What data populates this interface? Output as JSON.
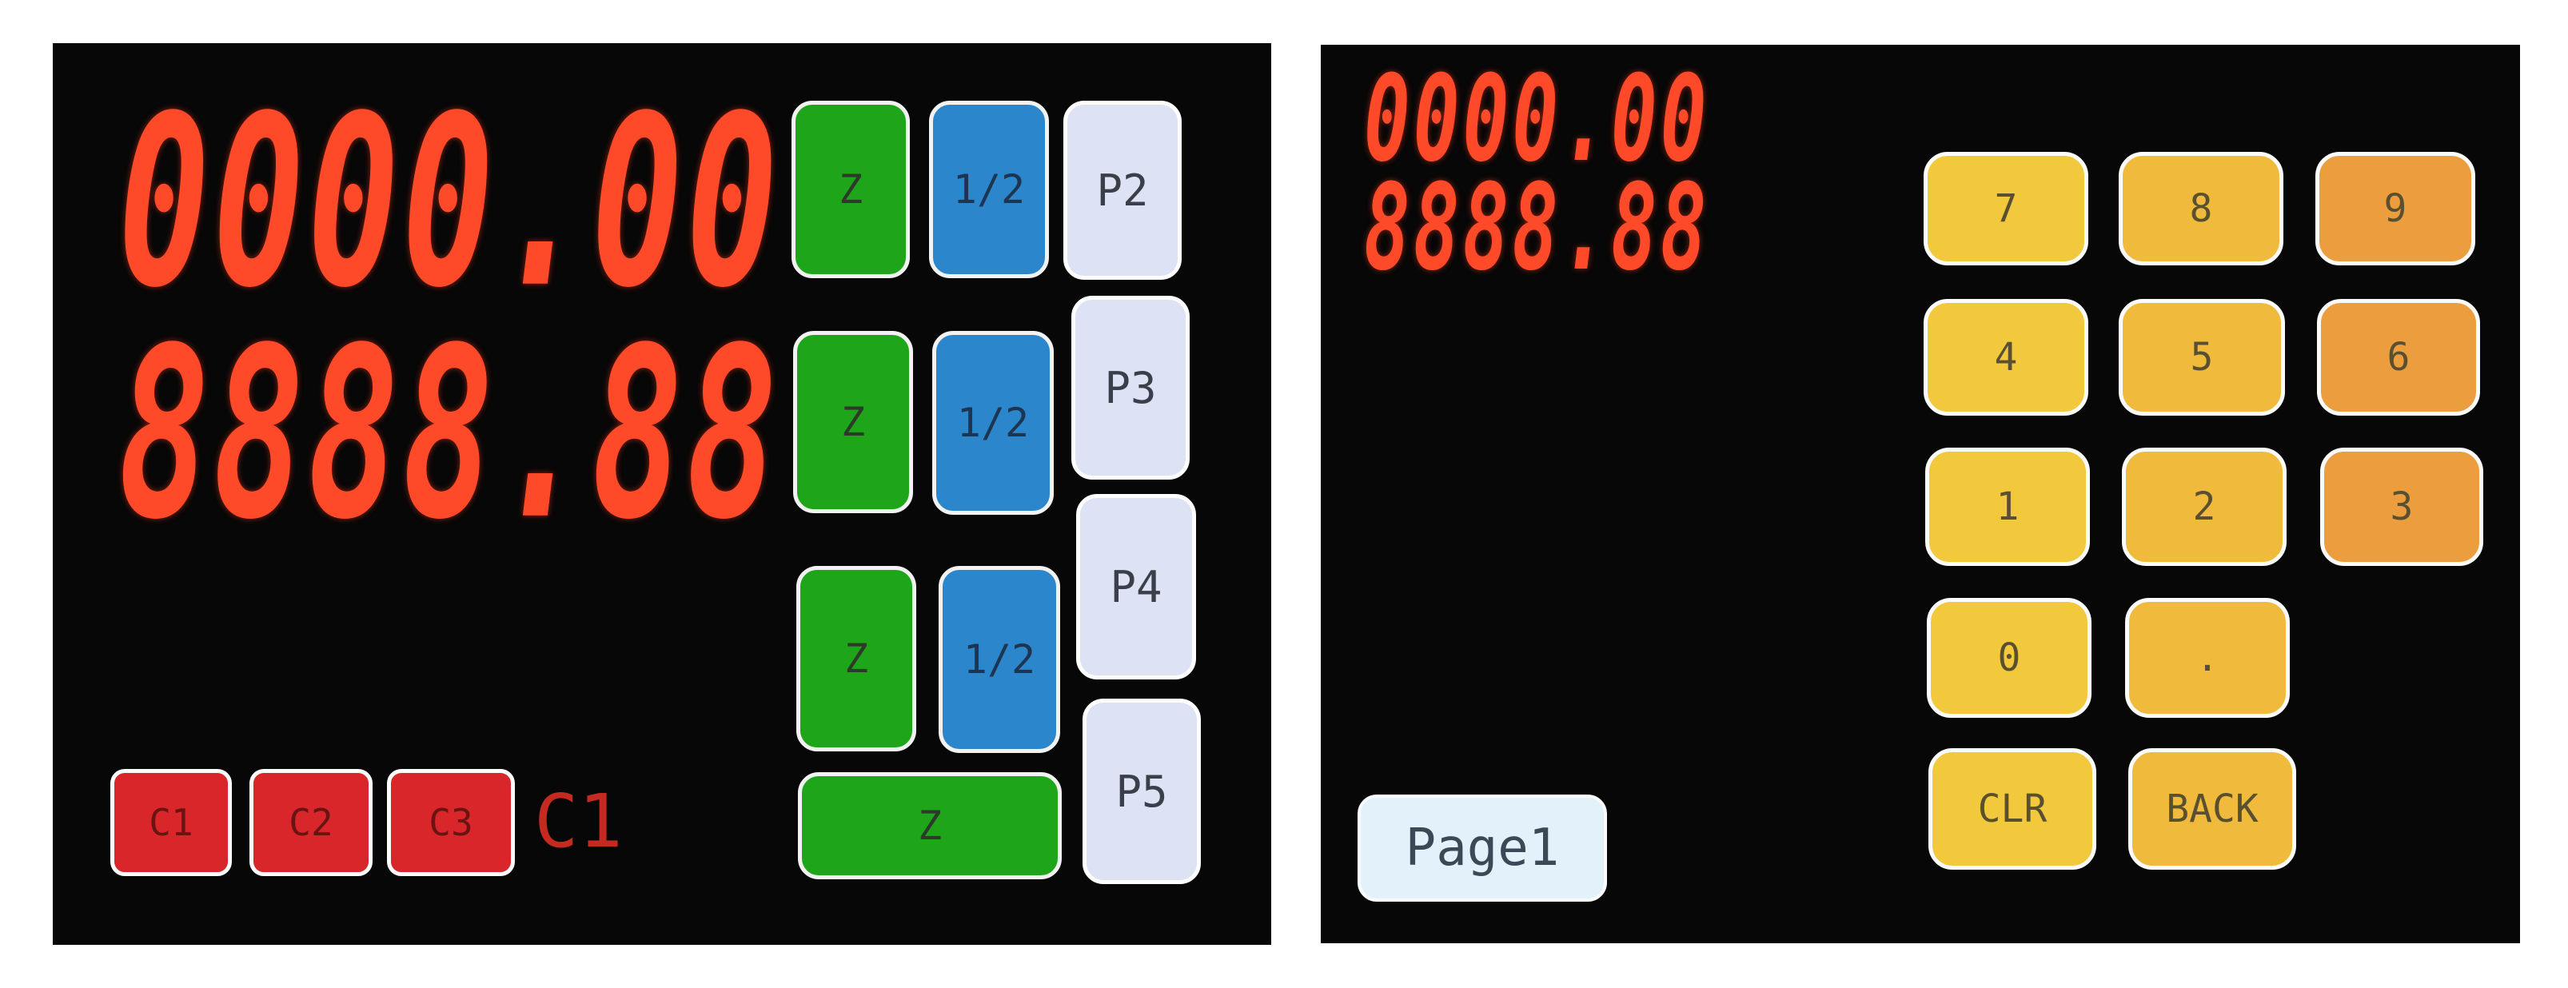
{
  "left_screen": {
    "display_1": "0000.00",
    "display_2": "8888.88",
    "axis_buttons": [
      {
        "zero": "Z",
        "half": "1/2"
      },
      {
        "zero": "Z",
        "half": "1/2"
      },
      {
        "zero": "Z",
        "half": "1/2"
      }
    ],
    "wide_zero": "Z",
    "page_buttons": [
      "P2",
      "P3",
      "P4",
      "P5"
    ],
    "c_buttons": [
      "C1",
      "C2",
      "C3"
    ],
    "c_status": "C1"
  },
  "right_screen": {
    "display_1": "0000.00",
    "display_2": "8888.88",
    "keypad": [
      "7",
      "8",
      "9",
      "4",
      "5",
      "6",
      "1",
      "2",
      "3",
      "0",
      ".",
      "CLR",
      "BACK"
    ],
    "page_button": "Page1"
  },
  "colors": {
    "segment_red": "#ff4a2a",
    "zero_green": "#1ea51a",
    "half_blue": "#2b86cc",
    "page_lavender": "#dde3f4",
    "c_red": "#d8262a",
    "key_yellow": "#f2c93d",
    "key_orange": "#ec9d3e"
  }
}
